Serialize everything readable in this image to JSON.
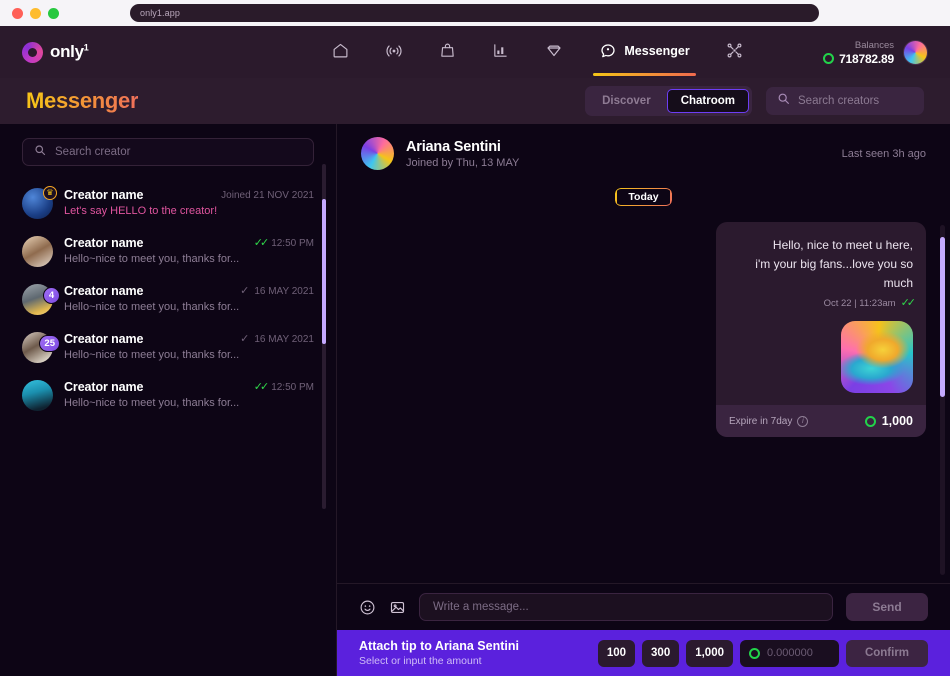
{
  "browser": {
    "url": "only1.app"
  },
  "nav": {
    "logo_text": "only",
    "logo_sup": "1",
    "items": [
      {
        "icon": "home-icon",
        "label": ""
      },
      {
        "icon": "broadcast-icon",
        "label": ""
      },
      {
        "icon": "bag-icon",
        "label": ""
      },
      {
        "icon": "bar-chart-icon",
        "label": ""
      },
      {
        "icon": "gem-icon",
        "label": ""
      },
      {
        "icon": "messenger-icon",
        "label": "Messenger"
      },
      {
        "icon": "network-icon",
        "label": ""
      }
    ],
    "balances_label": "Balances",
    "balance_value": "718782.89"
  },
  "header": {
    "title": "Messenger",
    "tabs": [
      {
        "label": "Discover",
        "active": false
      },
      {
        "label": "Chatroom",
        "active": true
      }
    ],
    "search_placeholder": "Search creators",
    "search_value": ""
  },
  "sidebar": {
    "search_placeholder": "Search creator",
    "search_value": "",
    "conversations": [
      {
        "name": "Creator name",
        "preview": "Let's say HELLO to the creator!",
        "time": "Joined 21 NOV 2021",
        "tick": "none",
        "badge": "crown",
        "highlight": true
      },
      {
        "name": "Creator name",
        "preview": "Hello~nice to meet you, thanks for...",
        "time": "12:50 PM",
        "tick": "read",
        "badge": "",
        "highlight": false
      },
      {
        "name": "Creator name",
        "preview": "Hello~nice to meet you, thanks for...",
        "time": "16 MAY 2021",
        "tick": "sent",
        "badge": "4",
        "highlight": false
      },
      {
        "name": "Creator name",
        "preview": "Hello~nice to meet you, thanks for...",
        "time": "16 MAY 2021",
        "tick": "sent",
        "badge": "25",
        "highlight": false
      },
      {
        "name": "Creator name",
        "preview": "Hello~nice to meet you, thanks for...",
        "time": "12:50 PM",
        "tick": "read",
        "badge": "",
        "highlight": false
      }
    ]
  },
  "chat": {
    "name": "Ariana Sentini",
    "joined": "Joined by Thu, 13 MAY",
    "last_seen": "Last seen 3h ago",
    "day_divider": "Today",
    "message": {
      "line1": "Hello, nice to meet u here,",
      "line2": "i'm your big fans...love you so much",
      "timestamp": "Oct 22 | 11:23am",
      "expire": "Expire in 7day",
      "tip_amount": "1,000"
    }
  },
  "composer": {
    "placeholder": "Write a message...",
    "value": "",
    "send_label": "Send"
  },
  "tipbar": {
    "title": "Attach tip to Ariana Sentini",
    "subtitle": "Select or input the amount",
    "amounts": [
      "100",
      "300",
      "1,000"
    ],
    "input_placeholder": "0.000000",
    "input_value": "",
    "confirm_label": "Confirm"
  },
  "colors": {
    "accent_purple": "#5b21dd",
    "token_green": "#22d34a",
    "tab_border": "#6d3df5",
    "title_gradient_start": "#f7c21a",
    "title_gradient_end": "#ef6f5b"
  }
}
